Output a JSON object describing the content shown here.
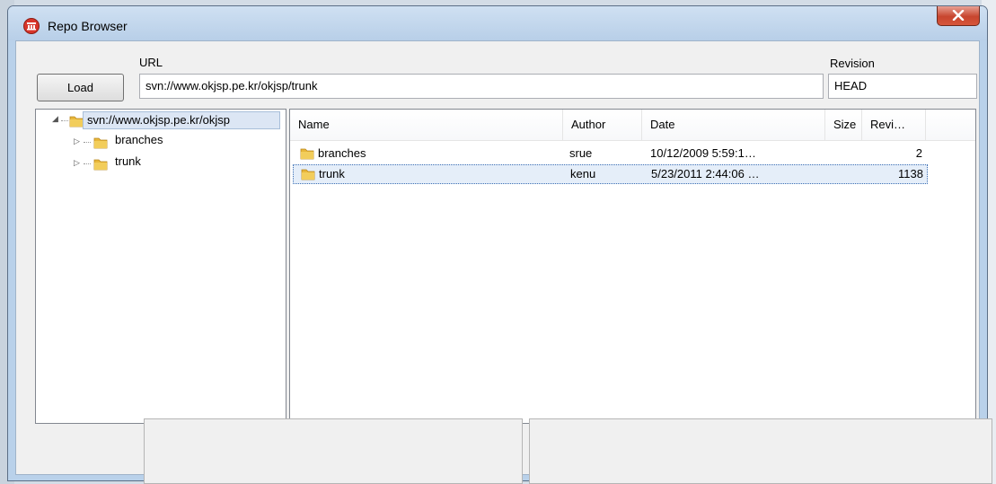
{
  "window": {
    "title": "Repo Browser",
    "close_symbol": "✕"
  },
  "toolbar": {
    "load_label": "Load",
    "url_label": "URL",
    "url_value": "svn://www.okjsp.pe.kr/okjsp/trunk",
    "revision_label": "Revision",
    "revision_value": "HEAD"
  },
  "tree": {
    "root": {
      "label": "svn://www.okjsp.pe.kr/okjsp",
      "expanded": true
    },
    "children": [
      {
        "label": "branches"
      },
      {
        "label": "trunk"
      }
    ]
  },
  "list": {
    "columns": [
      "Name",
      "Author",
      "Date",
      "Size",
      "Revi…"
    ],
    "rows": [
      {
        "name": "branches",
        "author": "srue",
        "date": "10/12/2009 5:59:1…",
        "size": "",
        "revision": "2",
        "selected": false
      },
      {
        "name": "trunk",
        "author": "kenu",
        "date": "5/23/2011 2:44:06 …",
        "size": "",
        "revision": "1138",
        "selected": true
      }
    ]
  },
  "colors": {
    "titlebar": "#b9d1ea",
    "close_button": "#c7452e",
    "folder": "#e8b73a",
    "selection": "#e5eef9"
  },
  "icons": {
    "app": "repo-browser-app-icon",
    "folder": "folder-icon",
    "expand": "expand-triangle-icon",
    "collapse": "collapse-triangle-icon",
    "close": "close-icon"
  }
}
